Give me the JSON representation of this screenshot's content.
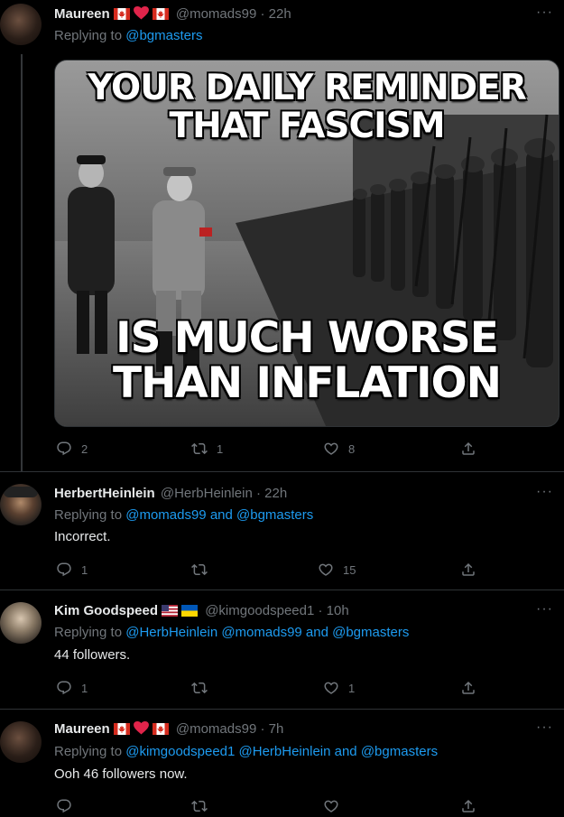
{
  "colors": {
    "background": "#000000",
    "text": "#e7e9ea",
    "muted": "#71767b",
    "link": "#1d9bf0"
  },
  "tweets": [
    {
      "name": "Maureen",
      "name_emoji": [
        "canada-flag",
        "red-heart",
        "canada-flag"
      ],
      "handle": "@momads99",
      "time": "· 22h",
      "replying_label": "Replying to",
      "replying_to": "@bgmasters",
      "media": {
        "line1": "YOUR DAILY REMINDER",
        "line2": "THAT FASCISM",
        "line3": "IS MUCH WORSE",
        "line4": "THAN INFLATION"
      },
      "replies": "2",
      "retweets": "1",
      "likes": "8"
    },
    {
      "name": "HerbertHeinlein",
      "handle": "@HerbHeinlein",
      "time": "· 22h",
      "replying_label": "Replying to",
      "replying_to": "@momads99 and @bgmasters",
      "text": "Incorrect.",
      "replies": "1",
      "retweets": "",
      "likes": "15"
    },
    {
      "name": "Kim Goodspeed",
      "name_emoji": [
        "us-flag",
        "ukraine-flag"
      ],
      "handle": "@kimgoodspeed1",
      "time": "· 10h",
      "replying_label": "Replying to",
      "replying_to": "@HerbHeinlein @momads99 and @bgmasters",
      "text": "44 followers.",
      "replies": "1",
      "retweets": "",
      "likes": "1"
    },
    {
      "name": "Maureen",
      "name_emoji": [
        "canada-flag",
        "red-heart",
        "canada-flag"
      ],
      "handle": "@momads99",
      "time": "· 7h",
      "replying_label": "Replying to",
      "replying_to": "@kimgoodspeed1 @HerbHeinlein and @bgmasters",
      "text": "Ooh 46 followers now.",
      "replies": "",
      "retweets": "",
      "likes": ""
    }
  ]
}
